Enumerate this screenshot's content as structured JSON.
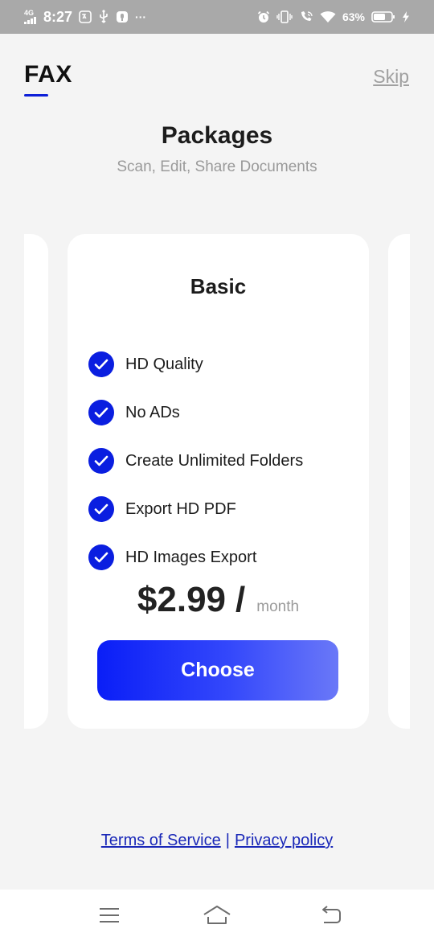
{
  "status_bar": {
    "network": "4G",
    "time": "8:27",
    "battery_percent": "63%",
    "more_glyph": "···",
    "icons_left": [
      "signal-icon",
      "translate-icon",
      "usb-icon",
      "notification-icon"
    ],
    "icons_right": [
      "alarm-icon",
      "vibrate-icon",
      "wifi-calling-icon",
      "wifi-icon",
      "battery-icon",
      "charging-icon"
    ]
  },
  "header": {
    "app_title": "FAX",
    "skip_label": "Skip"
  },
  "page": {
    "title": "Packages",
    "subtitle": "Scan, Edit, Share Documents"
  },
  "plan": {
    "name": "Basic",
    "features": [
      "HD Quality",
      "No ADs",
      "Create Unlimited Folders",
      "Export HD PDF",
      "HD Images Export"
    ],
    "price": "$2.99",
    "price_separator": "/",
    "period": "month",
    "cta_label": "Choose"
  },
  "footer": {
    "terms_label": "Terms of Service",
    "separator": "|",
    "privacy_label": "Privacy policy"
  },
  "nav_bar": {
    "buttons": [
      "menu-icon",
      "home-icon",
      "back-icon"
    ]
  },
  "colors": {
    "accent": "#0a1ee0",
    "cta_gradient_start": "#0a1ef7",
    "cta_gradient_end": "#6a78f8",
    "link": "#1a28b8",
    "background": "#f4f4f4",
    "status_bar": "#a9a9a9"
  }
}
